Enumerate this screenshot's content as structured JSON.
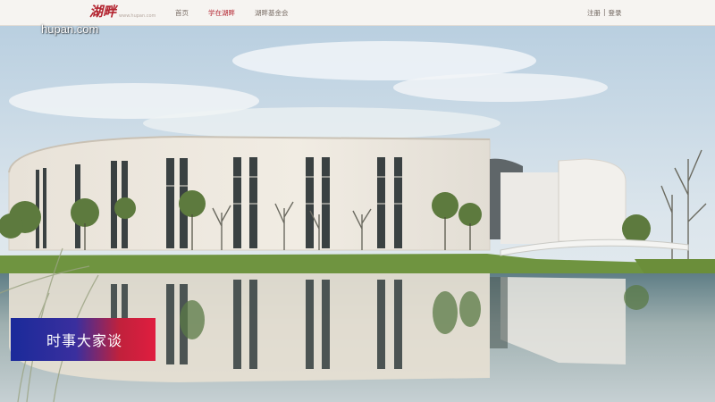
{
  "site": {
    "logo_text": "湖畔",
    "logo_url_text": "www.hupan.com"
  },
  "nav": {
    "items": [
      {
        "label": "首页"
      },
      {
        "label": "学在湖畔"
      },
      {
        "label": "湖畔基金会"
      }
    ],
    "active_index": 1
  },
  "auth": {
    "register_label": "注册",
    "separator": "|",
    "login_label": "登录"
  },
  "overlay": {
    "watermark": "hupan.com",
    "caption": "时事大家谈"
  },
  "colors": {
    "brand_red": "#b32430",
    "caption_blue": "#1a2a9a",
    "caption_red": "#e01d3f"
  }
}
